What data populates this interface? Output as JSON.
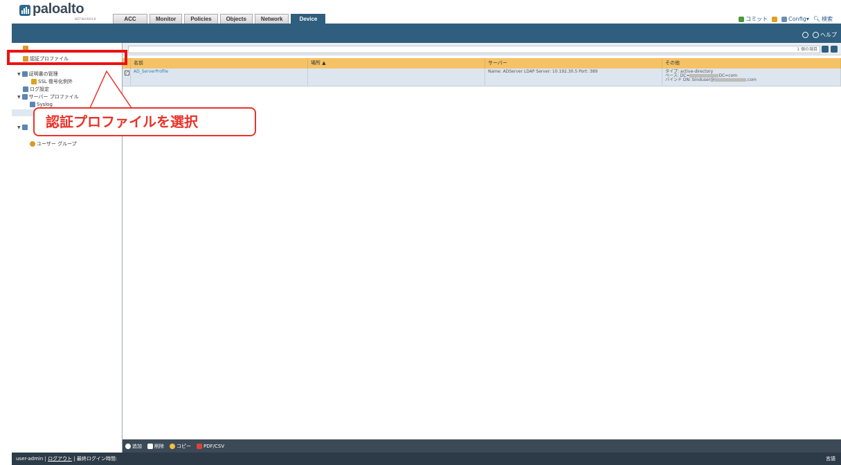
{
  "header": {
    "logo_text": "paloalto",
    "logo_sub": "NETWORKS®",
    "tabs": [
      "ACC",
      "Monitor",
      "Policies",
      "Objects",
      "Network",
      "Device"
    ],
    "active_tab": "Device",
    "actions": {
      "commit": "コミット",
      "config": "Config▾",
      "search": "検索"
    },
    "help": "ヘルプ"
  },
  "sidebar": {
    "items": [
      {
        "label": "認証プロファイル"
      },
      {
        "label": "証明書の管理"
      },
      {
        "label": "SSL 復号化例外"
      },
      {
        "label": "ログ設定"
      },
      {
        "label": "サーバー プロファイル"
      },
      {
        "label": "Syslog"
      },
      {
        "label": "ユーザー グループ"
      }
    ]
  },
  "toolbar": {
    "filter_count": "1 個の項目"
  },
  "grid": {
    "headers": [
      "名前",
      "場所 ▲",
      "サーバー",
      "その他"
    ],
    "rows": [
      {
        "name": "AD_ServerProfile",
        "location": "",
        "server": "Name: ADServer LDAP Server: 10.192.30.5 Port: 389",
        "other_type": "タイプ: active-directory",
        "other_base_prefix": "ベース: DC=",
        "other_base_suffix": "DC=com",
        "other_bind_prefix": "バインド DN: binduser@",
        "other_bind_suffix": ".com"
      }
    ]
  },
  "bottombar": {
    "add": "追加",
    "delete": "削除",
    "copy": "コピー",
    "pdf": "PDF/CSV"
  },
  "status": {
    "user": "user-admin",
    "logout": "ログアウト",
    "last_login": "最終ログイン時間:",
    "language": "言語"
  },
  "annotation": {
    "label": "認証プロファイルを選択"
  },
  "colors": {
    "blue": "#2f5e7e",
    "header": "#f5c266",
    "red": "#ee1111"
  }
}
